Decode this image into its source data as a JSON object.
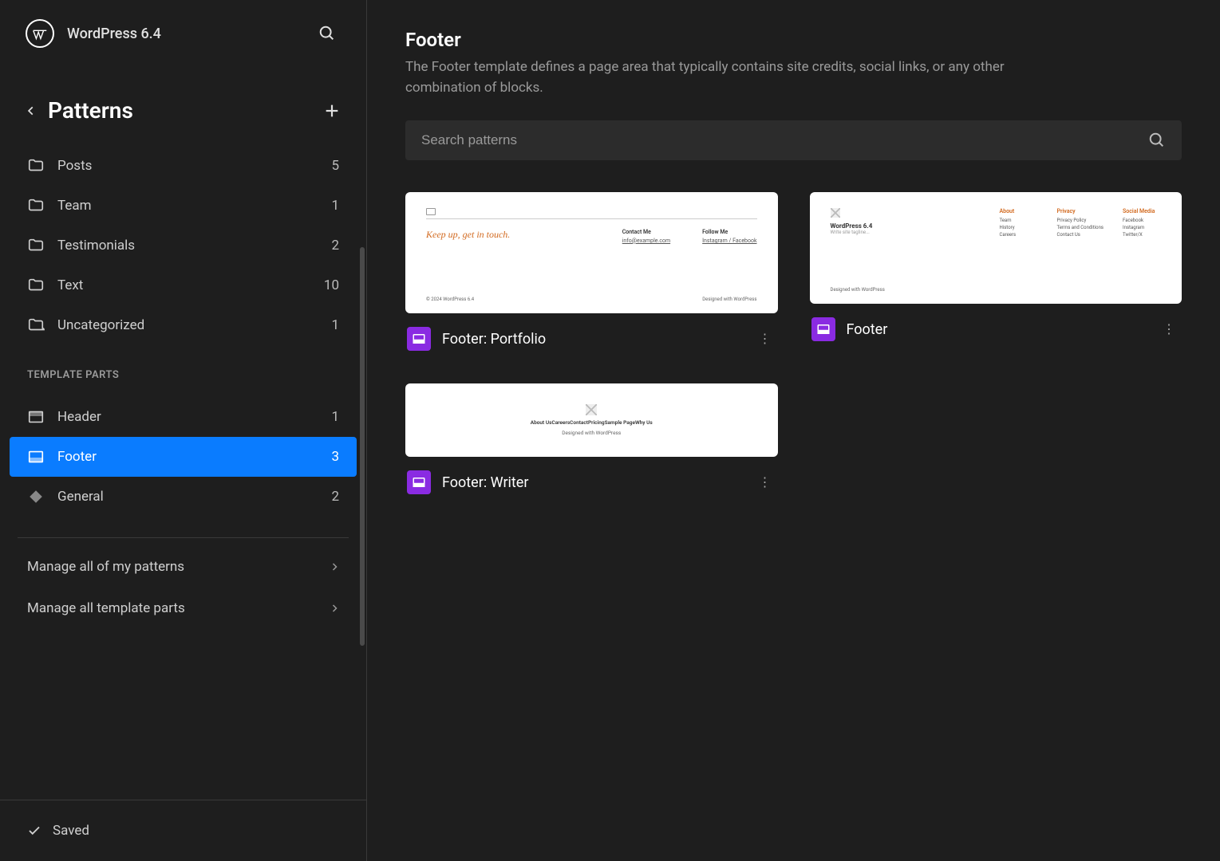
{
  "header": {
    "site_title": "WordPress 6.4"
  },
  "nav": {
    "section_title": "Patterns",
    "categories": [
      {
        "label": "Posts",
        "count": "5"
      },
      {
        "label": "Team",
        "count": "1"
      },
      {
        "label": "Testimonials",
        "count": "2"
      },
      {
        "label": "Text",
        "count": "10"
      },
      {
        "label": "Uncategorized",
        "count": "1"
      }
    ],
    "template_parts_label": "TEMPLATE PARTS",
    "template_parts": [
      {
        "label": "Header",
        "count": "1",
        "icon": "header"
      },
      {
        "label": "Footer",
        "count": "3",
        "icon": "footer",
        "active": true
      },
      {
        "label": "General",
        "count": "2",
        "icon": "general"
      }
    ],
    "manage": [
      {
        "label": "Manage all of my patterns"
      },
      {
        "label": "Manage all template parts"
      }
    ],
    "saved_label": "Saved"
  },
  "main": {
    "title": "Footer",
    "description": "The Footer template defines a page area that typically contains site credits, social links, or any other combination of blocks.",
    "search_placeholder": "Search patterns",
    "cards": [
      {
        "title": "Footer: Portfolio"
      },
      {
        "title": "Footer"
      },
      {
        "title": "Footer: Writer"
      }
    ]
  },
  "previews": {
    "portfolio": {
      "tagline": "Keep up, get in touch.",
      "contact_h": "Contact Me",
      "contact_email": "info@example.com",
      "follow_h": "Follow Me",
      "follow_links": "Instagram / Facebook",
      "copyright": "© 2024 WordPress 6.4",
      "designed": "Designed with WordPress"
    },
    "footer": {
      "site": "WordPress 6.4",
      "tagline": "Write site tagline...",
      "cols": [
        {
          "h": "About",
          "items": [
            "Team",
            "History",
            "Careers"
          ]
        },
        {
          "h": "Privacy",
          "items": [
            "Privacy Policy",
            "Terms and Conditions",
            "Contact Us"
          ]
        },
        {
          "h": "Social Media",
          "items": [
            "Facebook",
            "Instagram",
            "Twitter/X"
          ]
        }
      ],
      "designed": "Designed with WordPress"
    },
    "writer": {
      "nav": "About UsCareersContactPricingSample PageWhy Us",
      "designed": "Designed with WordPress"
    }
  }
}
